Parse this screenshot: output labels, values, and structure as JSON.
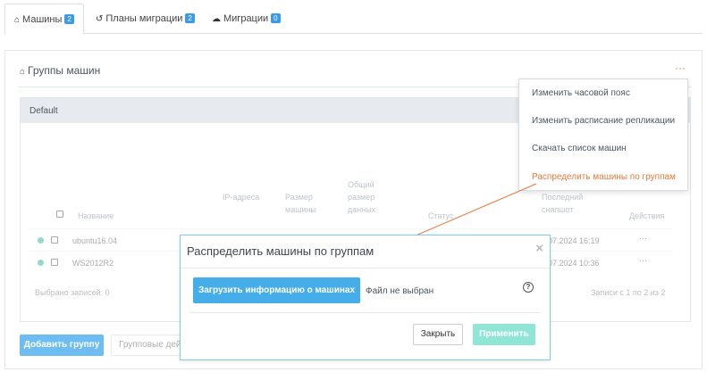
{
  "tabs": [
    {
      "label": "Машины",
      "count": "2",
      "icon": "home-icon"
    },
    {
      "label": "Планы миграции",
      "count": "2",
      "icon": "history-icon"
    },
    {
      "label": "Миграции",
      "count": "0",
      "icon": "cloud-icon"
    }
  ],
  "panel": {
    "title": "Группы машин",
    "menu_dots": "···"
  },
  "group": {
    "name": "Default",
    "columns": [
      "Название",
      "IP-адреса",
      "Размер машины",
      "Общий размер данных",
      "Статус",
      "Последний снапшот",
      "Действия"
    ],
    "rows": [
      {
        "name": "ubuntu16.04",
        "snapshot": "07.2024 16:19",
        "actions": "···"
      },
      {
        "name": "WS2012R2",
        "snapshot": "07.2024 10:36",
        "actions": "···"
      }
    ],
    "selected_text": "Выбрано записей: 0",
    "paging_text": "Записи с 1 по 2 из 2"
  },
  "bottom": {
    "add_group": "Добавить группу",
    "group_actions": "Групповые дей"
  },
  "menu": {
    "items": [
      "Изменить часовой пояс",
      "Изменить расписание репликации",
      "Скачать список машин",
      "Распределить машины по группам"
    ]
  },
  "modal": {
    "title": "Распределить машины по группам",
    "close_glyph": "×",
    "upload_label": "Загрузить информацию о машинах",
    "file_status": "Файл не выбран",
    "help_glyph": "?",
    "close_button": "Закрыть",
    "apply_button": "Применить"
  },
  "colors": {
    "accent": "#3ea7ee",
    "highlight": "#e67a3a",
    "online": "#27b39c",
    "apply_disabled": "#8fe6d6"
  }
}
